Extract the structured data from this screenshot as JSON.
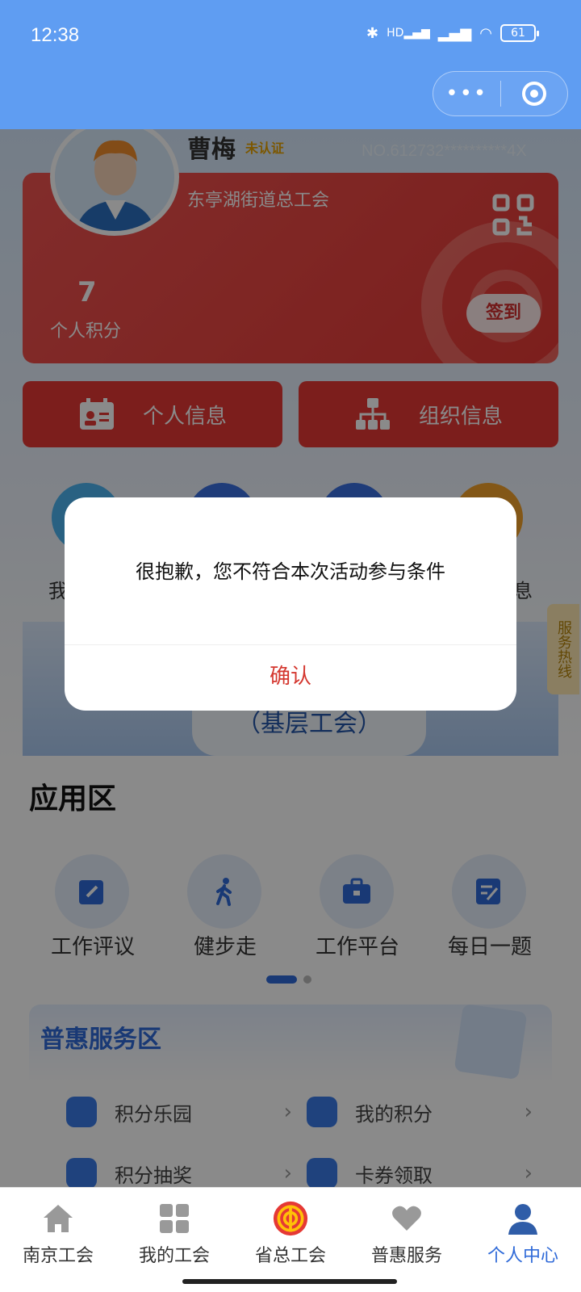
{
  "status_bar": {
    "time": "12:38",
    "network": "HD",
    "battery": "61"
  },
  "profile": {
    "name": "曹梅",
    "verify_status": "未认证",
    "card_no": "NO.612732**********4X",
    "union": "东亭湖街道总工会",
    "points_value": "7",
    "points_label": "个人积分",
    "checkin_label": "签到"
  },
  "info_buttons": [
    {
      "label": "个人信息",
      "icon": "id-card-icon"
    },
    {
      "label": "组织信息",
      "icon": "org-chart-icon"
    }
  ],
  "partial_labels": {
    "left": "我",
    "right": "息"
  },
  "hotline": "服务热线",
  "banner_text": "（基层工会）",
  "app_section": {
    "title": "应用区",
    "items": [
      {
        "label": "工作评议",
        "icon": "edit-icon"
      },
      {
        "label": "健步走",
        "icon": "walk-icon"
      },
      {
        "label": "工作平台",
        "icon": "briefcase-icon"
      },
      {
        "label": "每日一题",
        "icon": "quiz-icon"
      }
    ]
  },
  "service_section": {
    "title": "普惠服务区",
    "items": [
      {
        "label": "积分乐园",
        "icon": "crown-icon"
      },
      {
        "label": "我的积分",
        "icon": "coins-icon"
      },
      {
        "label": "积分抽奖",
        "icon": "gift-icon"
      },
      {
        "label": "卡券领取",
        "icon": "ticket-icon"
      }
    ]
  },
  "dialog": {
    "message": "很抱歉，您不符合本次活动参与条件",
    "confirm_label": "确认"
  },
  "tabbar": [
    {
      "label": "南京工会",
      "icon": "home-icon"
    },
    {
      "label": "我的工会",
      "icon": "grid-icon"
    },
    {
      "label": "省总工会",
      "icon": "union-logo-icon"
    },
    {
      "label": "普惠服务",
      "icon": "heart-hand-icon"
    },
    {
      "label": "个人中心",
      "icon": "person-icon",
      "active": true
    }
  ],
  "colors": {
    "accent": "#2f6ad8",
    "card_red": "#e53935",
    "topbar": "#5f9df2",
    "confirm": "#d4372f"
  }
}
